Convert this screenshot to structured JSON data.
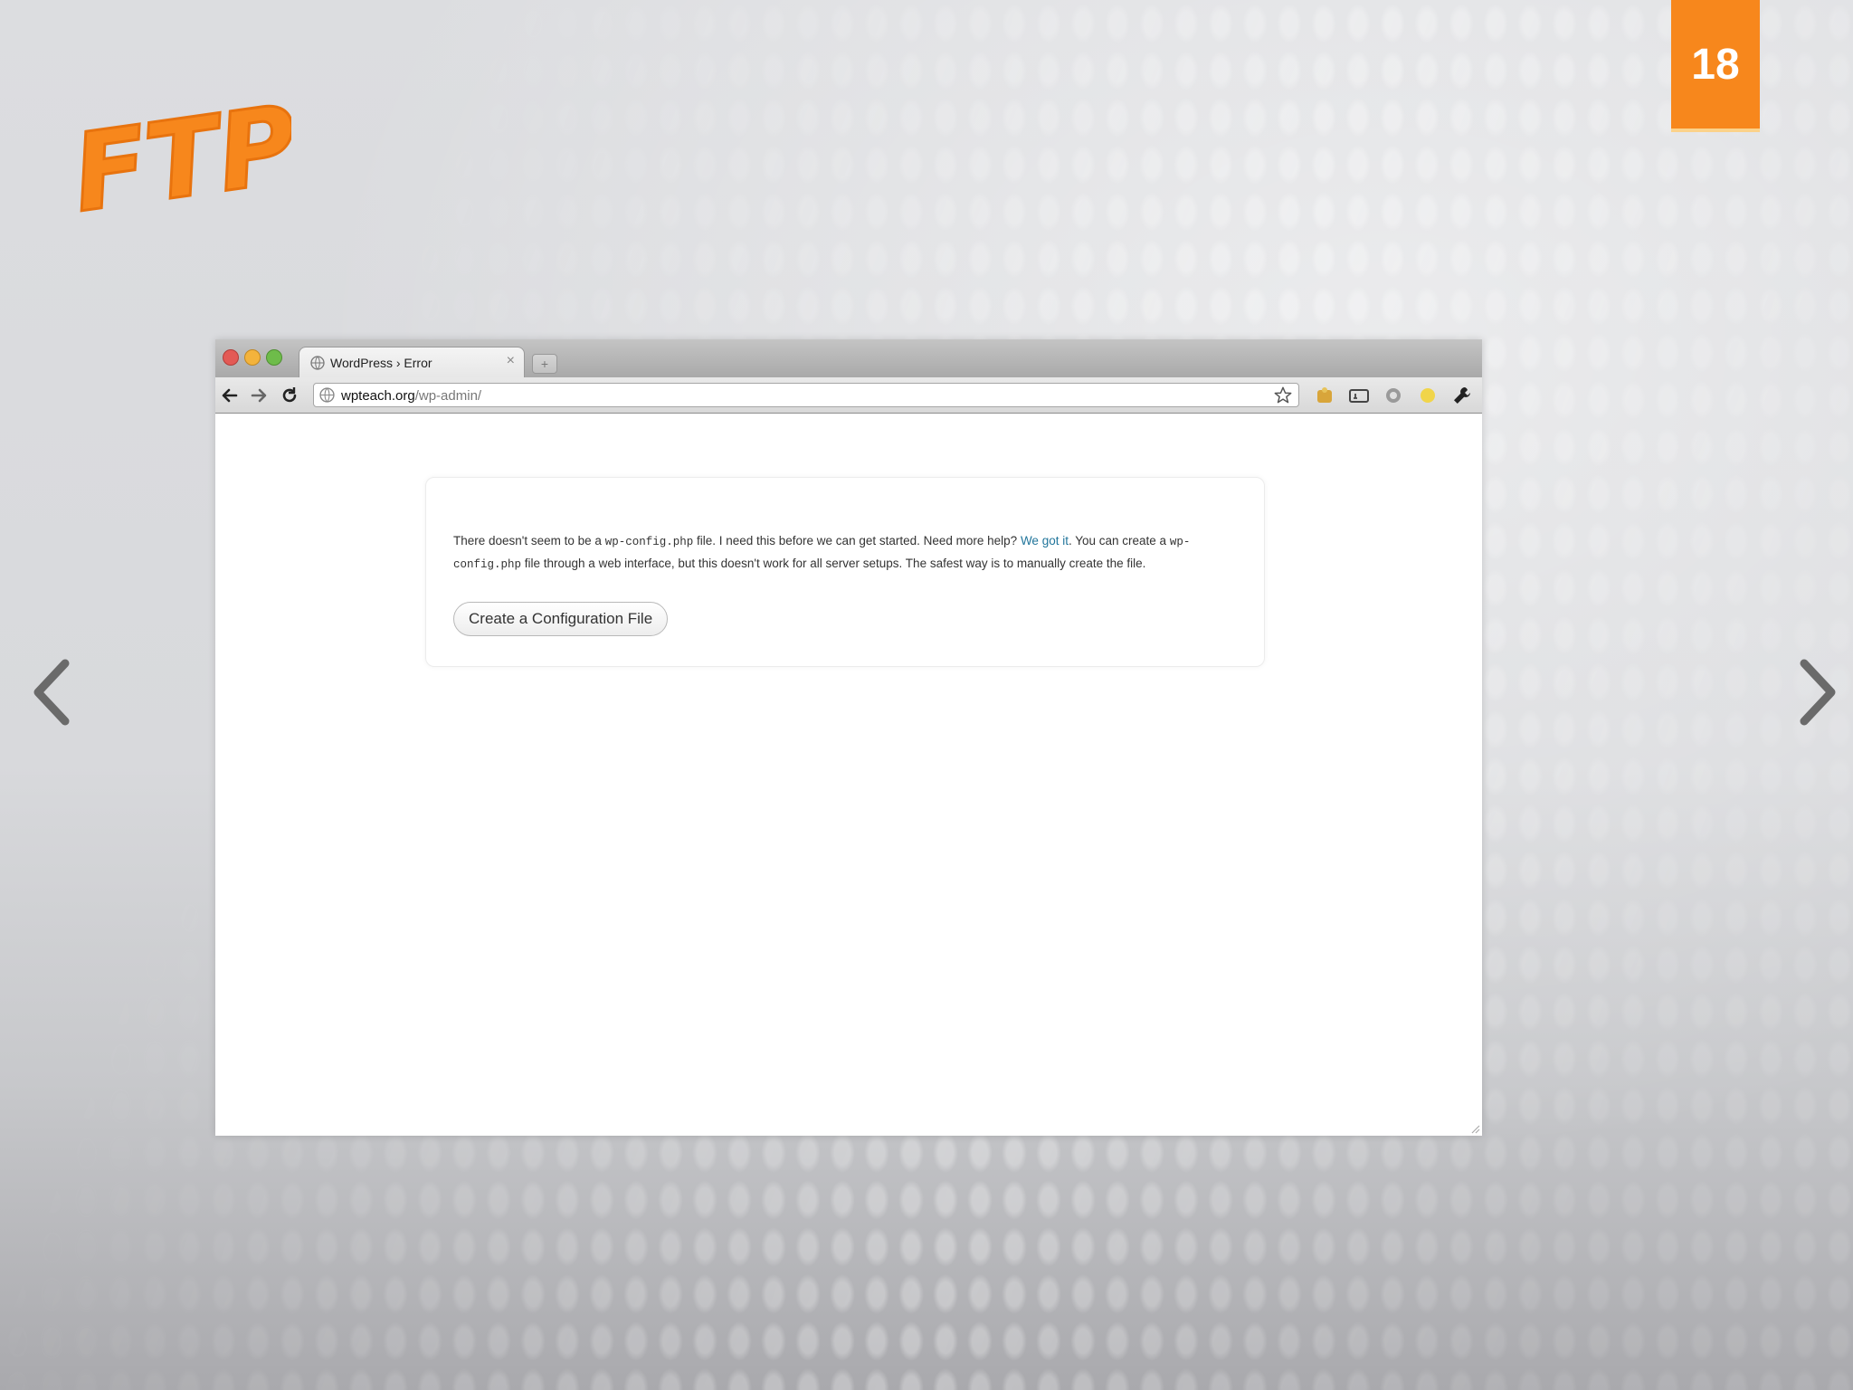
{
  "slide": {
    "logo_text": "FTP",
    "page_number": "18",
    "prev_icon": "chevron-left-icon",
    "next_icon": "chevron-right-icon",
    "accent_color": "#f7871c"
  },
  "browser": {
    "tab": {
      "title": "WordPress › Error",
      "close_label": "×",
      "favicon": "globe-icon"
    },
    "new_tab_label": "+",
    "address": {
      "domain": "wpteach.org",
      "path": "/wp-admin/"
    },
    "toolbar_icons": [
      "back-arrow-icon",
      "forward-arrow-icon",
      "reload-icon",
      "star-icon",
      "extension-icon",
      "wrench-icon"
    ]
  },
  "page": {
    "message": {
      "part1": "There doesn't seem to be a ",
      "code1": "wp-config.php",
      "part2": " file. I need this before we can get started. Need more help? ",
      "link": "We got it",
      "part3": ". You can create a ",
      "code2": "wp-config.php",
      "part4": " file through a web interface, but this doesn't work for all server setups. The safest way is to manually create the file."
    },
    "button_label": "Create a Configuration File",
    "link_color": "#21759b"
  }
}
